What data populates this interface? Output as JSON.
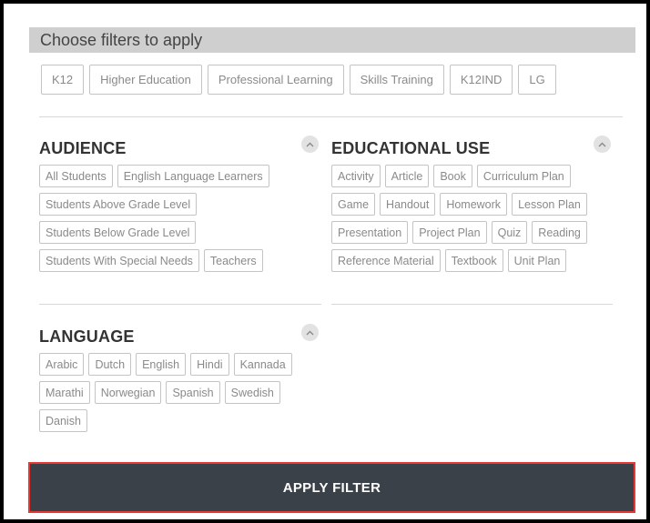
{
  "header": {
    "title": "Choose filters to apply"
  },
  "top_filters": [
    "K12",
    "Higher Education",
    "Professional Learning",
    "Skills Training",
    "K12IND",
    "LG"
  ],
  "audience": {
    "title": "AUDIENCE",
    "rows": [
      [
        "All Students",
        "English Language Learners"
      ],
      [
        "Students Above Grade Level"
      ],
      [
        "Students Below Grade Level"
      ],
      [
        "Students With Special Needs",
        "Teachers"
      ]
    ]
  },
  "educational_use": {
    "title": "EDUCATIONAL USE",
    "rows": [
      [
        "Activity",
        "Article",
        "Book",
        "Curriculum Plan"
      ],
      [
        "Game",
        "Handout",
        "Homework",
        "Lesson Plan"
      ],
      [
        "Presentation",
        "Project Plan",
        "Quiz",
        "Reading"
      ],
      [
        "Reference Material",
        "Textbook",
        "Unit Plan"
      ]
    ]
  },
  "language": {
    "title": "LANGUAGE",
    "rows": [
      [
        "Arabic",
        "Dutch",
        "English",
        "Hindi",
        "Kannada"
      ],
      [
        "Marathi",
        "Norwegian",
        "Spanish",
        "Swedish"
      ],
      [
        "Danish"
      ]
    ]
  },
  "apply_button": {
    "label": "APPLY FILTER"
  },
  "colors": {
    "header_bg": "#cfcfcf",
    "chip_border": "#c4c4c4",
    "chip_text": "#8a8a8a",
    "button_bg": "#3a4149",
    "button_outline": "#e53935"
  },
  "icons": {
    "collapse": "chevron-up-icon"
  }
}
